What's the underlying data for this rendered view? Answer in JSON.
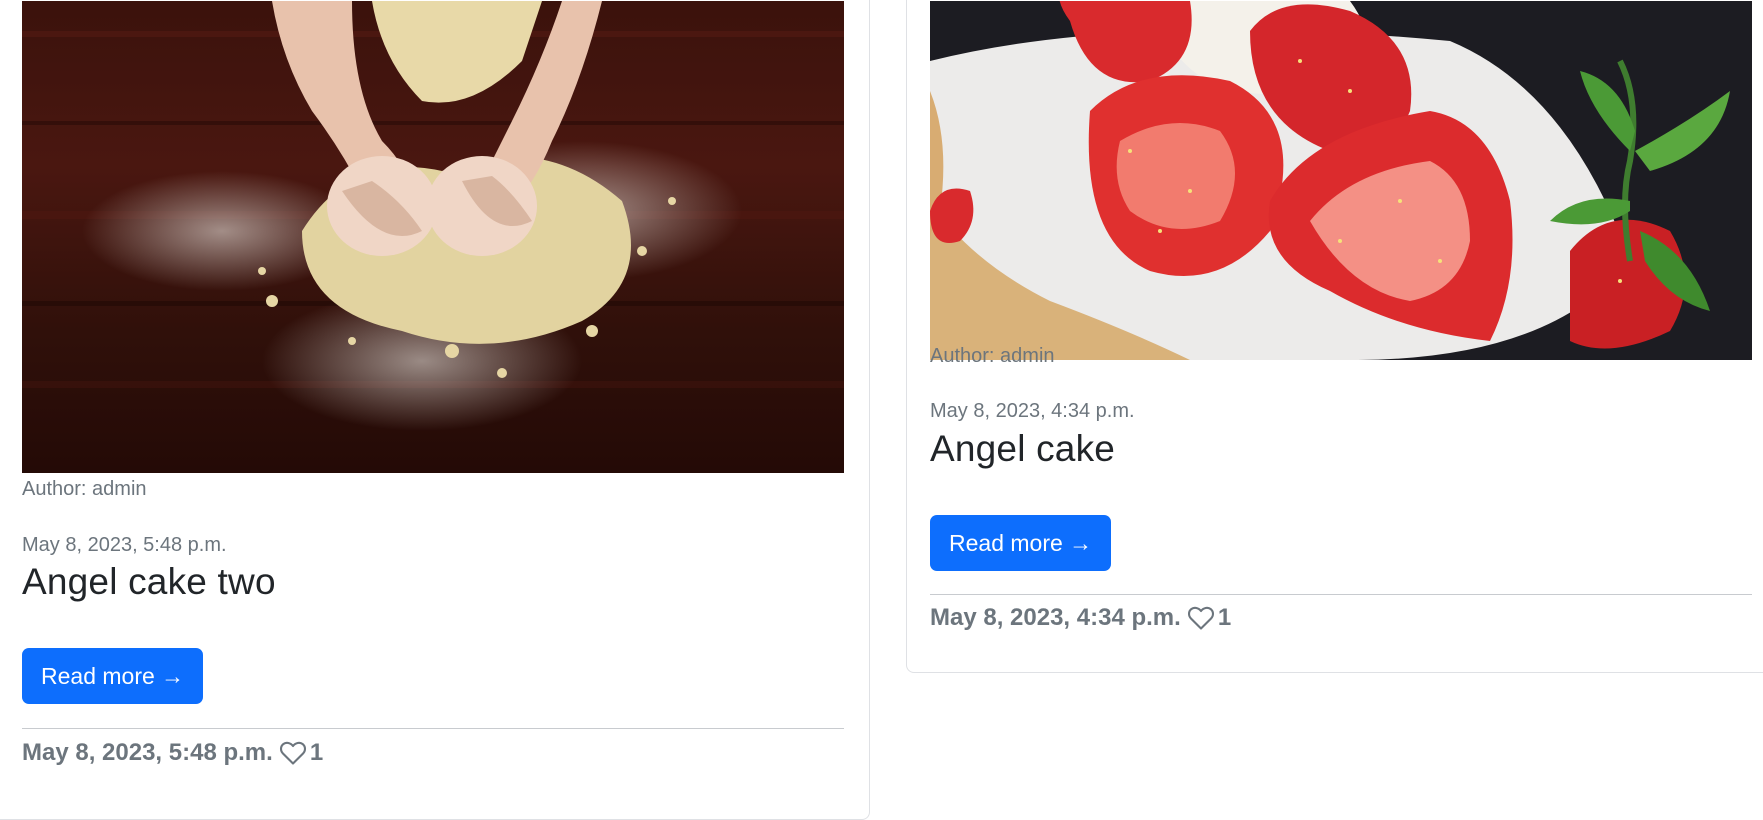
{
  "posts": [
    {
      "image_alt": "Hands kneading crumbly dough on a dark wooden table",
      "author": "Author: admin",
      "date": "May 8, 2023, 5:48 p.m.",
      "title": "Angel cake two",
      "read_more": "Read more →",
      "footer_date": "May 8, 2023, 5:48 p.m.",
      "likes": "1"
    },
    {
      "image_alt": "Angel cake slice topped with halved strawberries",
      "author": "Author: admin",
      "date": "May 8, 2023, 4:34 p.m.",
      "title": "Angel cake",
      "read_more": "Read more →",
      "footer_date": "May 8, 2023, 4:34 p.m.",
      "likes": "1"
    }
  ],
  "icons": {
    "like": "heart-icon"
  },
  "colors": {
    "button": "#0d6efd",
    "muted_text": "#6c757d",
    "title_text": "#212529"
  }
}
